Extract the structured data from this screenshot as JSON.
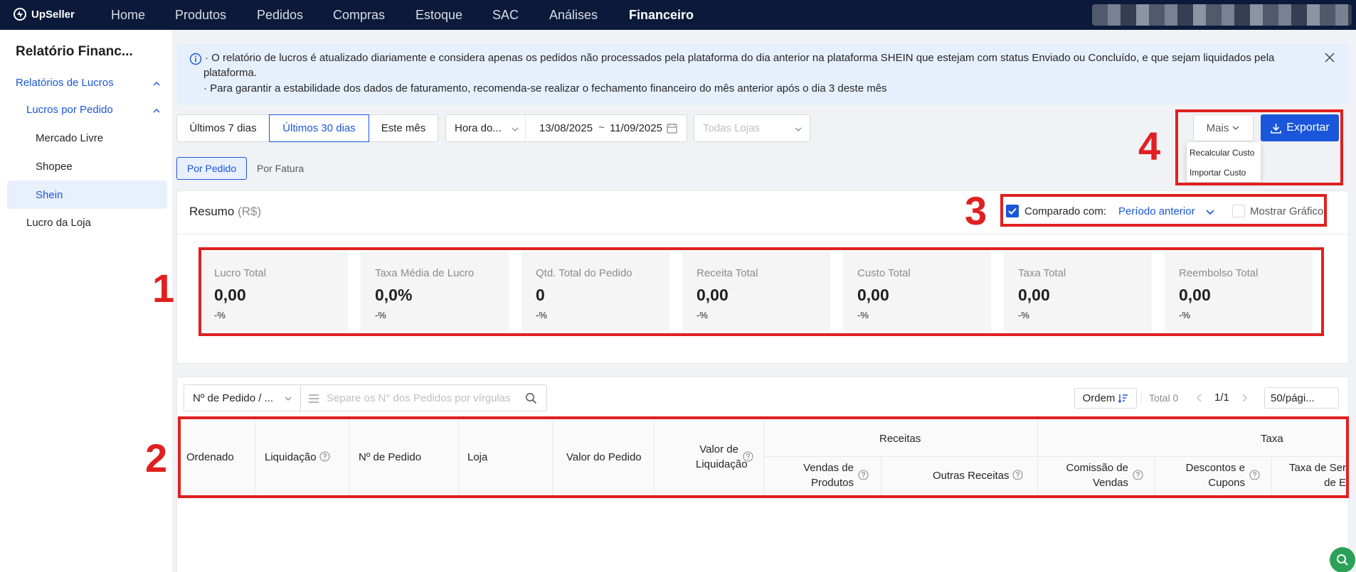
{
  "topbar": {
    "logo_text": "UpSeller",
    "nav": [
      {
        "label": "Home"
      },
      {
        "label": "Produtos"
      },
      {
        "label": "Pedidos"
      },
      {
        "label": "Compras"
      },
      {
        "label": "Estoque"
      },
      {
        "label": "SAC"
      },
      {
        "label": "Análises"
      },
      {
        "label": "Financeiro",
        "active": true
      }
    ]
  },
  "sidebar": {
    "title": "Relatório Financ...",
    "items": [
      {
        "label": "Relatórios de Lucros"
      },
      {
        "label": "Lucros por Pedido"
      },
      {
        "label": "Mercado Livre"
      },
      {
        "label": "Shopee"
      },
      {
        "label": "Shein",
        "selected": true
      },
      {
        "label": "Lucro da Loja"
      }
    ]
  },
  "banner": {
    "line1": "· O relatório de lucros é atualizado diariamente e considera apenas os pedidos não processados pela plataforma do dia anterior na plataforma SHEIN que estejam com status Enviado ou Concluído, e que sejam liquidados pela",
    "line2": "plataforma.",
    "line3": "· Para garantir a estabilidade dos dados de faturamento, recomenda-se realizar o fechamento financeiro do mês anterior após o dia 3 deste mês"
  },
  "filters": {
    "range_7": "Últimos 7 dias",
    "range_30": "Últimos 30 dias",
    "this_month": "Este mês",
    "time_type": "Hora do...",
    "date_start": "13/08/2025",
    "date_sep": "~",
    "date_end": "11/09/2025",
    "stores_placeholder": "Todas Lojas",
    "more": "Mais",
    "export": "Exportar",
    "more_menu": [
      "Recalcular Custo",
      "Importar Custo"
    ]
  },
  "view_tabs": {
    "by_order": "Por Pedido",
    "by_invoice": "Por Fatura"
  },
  "summary": {
    "title": "Resumo",
    "currency": "(R$)",
    "compare_label": "Comparado com:",
    "compare_value": "Período anterior",
    "show_chart": "Mostrar Gráfico",
    "compare_checked": true,
    "show_chart_checked": false,
    "cards": [
      {
        "label": "Lucro Total",
        "value": "0,00",
        "change": "-%"
      },
      {
        "label": "Taxa Média de Lucro",
        "value": "0,0%",
        "change": "-%"
      },
      {
        "label": "Qtd. Total do Pedido",
        "value": "0",
        "change": "-%"
      },
      {
        "label": "Receita Total",
        "value": "0,00",
        "change": "-%"
      },
      {
        "label": "Custo Total",
        "value": "0,00",
        "change": "-%"
      },
      {
        "label": "Taxa Total",
        "value": "0,00",
        "change": "-%"
      },
      {
        "label": "Reembolso Total",
        "value": "0,00",
        "change": "-%"
      }
    ]
  },
  "table_toolbar": {
    "search_type": "Nº de Pedido / ...",
    "search_placeholder": "Separe os N° dos Pedidos por vírgulas",
    "order_btn": "Ordem",
    "total": "Total 0",
    "page": "1/1",
    "page_size": "50/pági..."
  },
  "table": {
    "columns": {
      "ordenado": "Ordenado",
      "liquidacao": "Liquidação",
      "num_pedido": "Nº de Pedido",
      "loja": "Loja",
      "valor_pedido": "Valor do Pedido",
      "valor_liq_1": "Valor de",
      "valor_liq_2": "Liquidação",
      "receitas": "Receitas",
      "vendas_1": "Vendas de",
      "vendas_2": "Produtos",
      "outras": "Outras Receitas",
      "taxa": "Taxa",
      "comissao_1": "Comissão de",
      "comissao_2": "Vendas",
      "descontos_1": "Descontos e",
      "descontos_2": "Cupons",
      "taxa_serv_1": "Taxa de Ser",
      "taxa_serv_2": "de E"
    }
  },
  "annotations": {
    "n1": "1",
    "n2": "2",
    "n3": "3",
    "n4": "4"
  },
  "colors": {
    "brand_blue": "#1a56db",
    "topbar": "#0b1a3a",
    "annotation_red": "#e02020"
  }
}
